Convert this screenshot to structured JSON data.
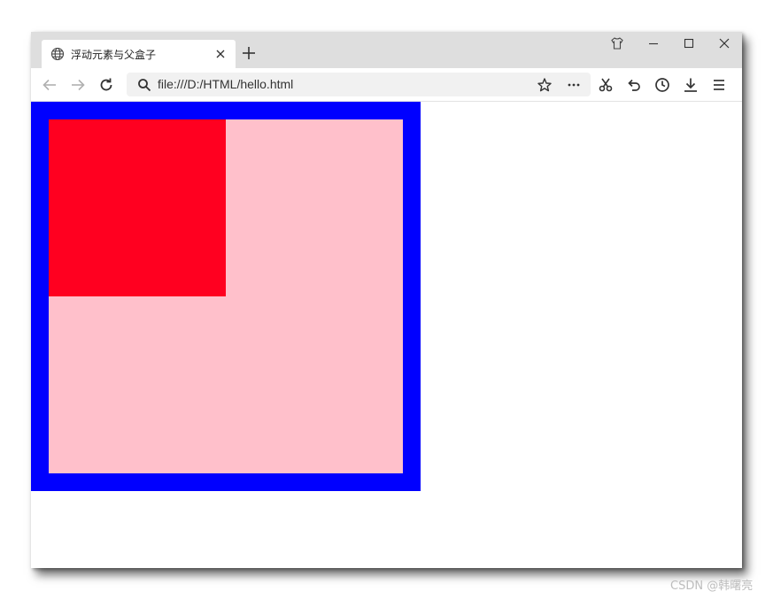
{
  "tab": {
    "title": "浮动元素与父盒子",
    "icon": "globe-icon"
  },
  "toolbar": {
    "url": "file:///D:/HTML/hello.html",
    "icons": [
      "back-icon",
      "forward-icon",
      "reload-icon",
      "search-icon",
      "star-icon",
      "more-icon",
      "scissors-icon",
      "undo-icon",
      "history-icon",
      "download-icon",
      "menu-icon"
    ]
  },
  "page": {
    "parent_box": {
      "background": "#ffc0cb",
      "border_color": "#0000ff"
    },
    "float_box": {
      "background": "#ff0020"
    }
  },
  "watermark": "CSDN @韩曙亮"
}
